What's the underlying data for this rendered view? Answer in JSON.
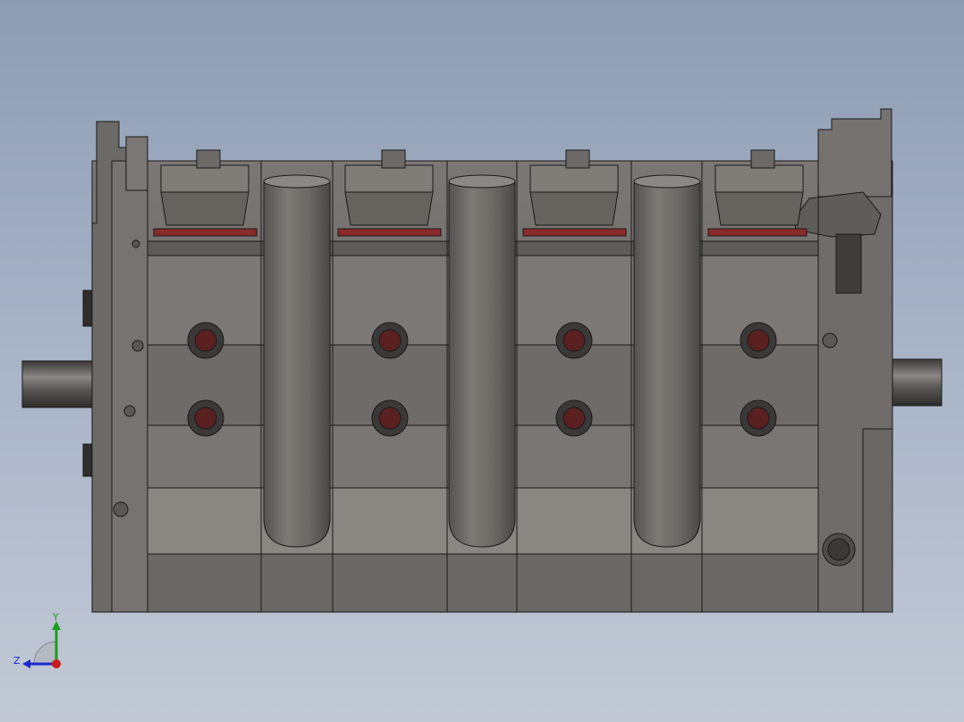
{
  "viewport": {
    "background_top": "#8e9db4",
    "background_bottom": "#c2c9d6",
    "model_color": "#6f6c68",
    "model_light": "#8a8783",
    "model_dark": "#4f4d4b",
    "edge_color": "#1a1a1a",
    "accent_red": "#8b2a2a"
  },
  "model": {
    "cylinder_count": 4,
    "tube_count": 3
  },
  "triad": {
    "y_label": "Y",
    "z_label": "Z",
    "y_color": "#1aa01a",
    "z_color": "#1a2acc",
    "x_color": "#cc1a1a",
    "icon": "coordinate-triad-icon"
  }
}
